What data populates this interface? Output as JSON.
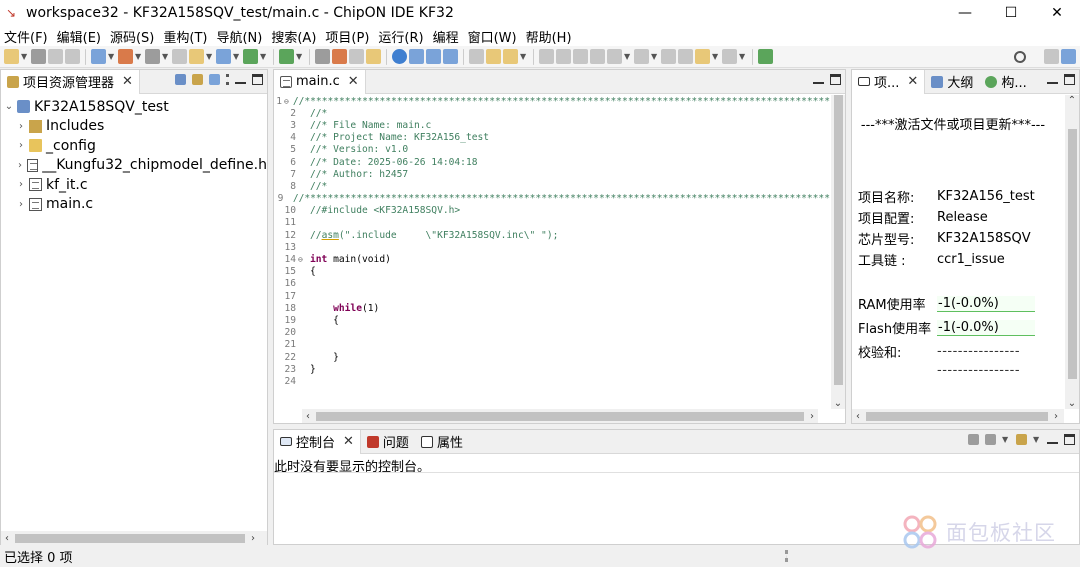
{
  "window": {
    "title": "workspace32 - KF32A158SQV_test/main.c - ChipON IDE KF32",
    "controls": {
      "minimize": "—",
      "maximize": "☐",
      "close": "✕"
    }
  },
  "menu": [
    "文件(F)",
    "编辑(E)",
    "源码(S)",
    "重构(T)",
    "导航(N)",
    "搜索(A)",
    "项目(P)",
    "运行(R)",
    "编程",
    "窗口(W)",
    "帮助(H)"
  ],
  "explorer": {
    "tab_label": "项目资源管理器",
    "close": "✕",
    "tree": [
      {
        "label": "KF32A158SQV_test",
        "chev": "⌄",
        "icon": "project"
      },
      {
        "label": "Includes",
        "chev": "›",
        "icon": "library"
      },
      {
        "label": "_config",
        "chev": "›",
        "icon": "folder"
      },
      {
        "label": "__Kungfu32_chipmodel_define.h",
        "chev": "›",
        "icon": "header"
      },
      {
        "label": "kf_it.c",
        "chev": "›",
        "icon": "source"
      },
      {
        "label": "main.c",
        "chev": "›",
        "icon": "source"
      }
    ]
  },
  "editor": {
    "tab_label": "main.c",
    "close": "✕",
    "lines": [
      {
        "n": "1",
        "fold": "⊖",
        "segments": [
          {
            "t": "//*******************************************************************************************",
            "c": "cm"
          }
        ]
      },
      {
        "n": "2",
        "segments": [
          {
            "t": "//*",
            "c": "cm"
          }
        ]
      },
      {
        "n": "3",
        "segments": [
          {
            "t": "//* File Name: main.c",
            "c": "cm"
          }
        ]
      },
      {
        "n": "4",
        "segments": [
          {
            "t": "//* Project Name: KF32A156_test",
            "c": "cm"
          }
        ]
      },
      {
        "n": "5",
        "segments": [
          {
            "t": "//* Version: v1.0",
            "c": "cm"
          }
        ]
      },
      {
        "n": "6",
        "segments": [
          {
            "t": "//* Date: 2025-06-26 14:04:18",
            "c": "cm"
          }
        ]
      },
      {
        "n": "7",
        "segments": [
          {
            "t": "//* Author: h2457",
            "c": "cm"
          }
        ]
      },
      {
        "n": "8",
        "segments": [
          {
            "t": "//*",
            "c": "cm"
          }
        ]
      },
      {
        "n": "9",
        "segments": [
          {
            "t": "//*******************************************************************************************",
            "c": "cm"
          }
        ]
      },
      {
        "n": "10",
        "segments": [
          {
            "t": "//#include <KF32A158SQV.h>",
            "c": "cm"
          }
        ]
      },
      {
        "n": "11",
        "segments": []
      },
      {
        "n": "12",
        "segments": [
          {
            "t": "//",
            "c": "cm"
          },
          {
            "t": "asm",
            "c": "asm"
          },
          {
            "t": "(\".include     \\\"KF32A158SQV.inc\\\" \");",
            "c": "cm"
          }
        ]
      },
      {
        "n": "13",
        "segments": []
      },
      {
        "n": "14",
        "fold": "⊖",
        "segments": [
          {
            "t": "int ",
            "c": "kw"
          },
          {
            "t": "main(void)",
            "c": ""
          }
        ]
      },
      {
        "n": "15",
        "segments": [
          {
            "t": "{",
            "c": ""
          }
        ]
      },
      {
        "n": "16",
        "segments": []
      },
      {
        "n": "17",
        "segments": []
      },
      {
        "n": "18",
        "segments": [
          {
            "t": "    ",
            "c": ""
          },
          {
            "t": "while",
            "c": "kw"
          },
          {
            "t": "(1)",
            "c": ""
          }
        ]
      },
      {
        "n": "19",
        "segments": [
          {
            "t": "    {",
            "c": ""
          }
        ]
      },
      {
        "n": "20",
        "segments": []
      },
      {
        "n": "21",
        "segments": []
      },
      {
        "n": "22",
        "segments": [
          {
            "t": "    }",
            "c": ""
          }
        ]
      },
      {
        "n": "23",
        "segments": [
          {
            "t": "}",
            "c": ""
          }
        ]
      },
      {
        "n": "24",
        "segments": []
      }
    ]
  },
  "right_panel": {
    "tabs": [
      {
        "label": "项...",
        "close": "✕"
      },
      {
        "label": "大纲"
      },
      {
        "label": "构..."
      }
    ],
    "header": "---***激活文件或项目更新***---",
    "fields": [
      {
        "key": "项目名称:",
        "value": "KF32A156_test"
      },
      {
        "key": "项目配置:",
        "value": "Release"
      },
      {
        "key": "芯片型号:",
        "value": "KF32A158SQV"
      },
      {
        "key": "工具链 :",
        "value": "ccr1_issue"
      }
    ],
    "ram_label": "RAM使用率",
    "ram_value": "-1(-0.0%)",
    "flash_label": "Flash使用率",
    "flash_value": "-1(-0.0%)",
    "checksum_label": "校验和:",
    "checksum_line1": "----------------",
    "checksum_line2": "----------------"
  },
  "console": {
    "tabs": [
      {
        "label": "控制台",
        "close": "✕"
      },
      {
        "label": "问题"
      },
      {
        "label": "属性"
      }
    ],
    "message": "此时没有要显示的控制台。"
  },
  "status": {
    "text": "已选择 0 项"
  },
  "watermark": {
    "text": "面包板社区"
  }
}
